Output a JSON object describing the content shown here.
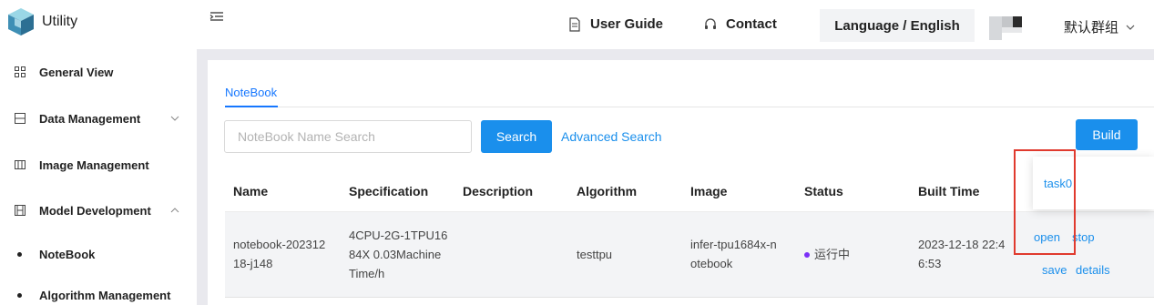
{
  "app": {
    "name": "Utility"
  },
  "header": {
    "user_guide": "User Guide",
    "contact": "Contact",
    "language": "Language / English",
    "group": "默认群组"
  },
  "sidebar": {
    "items": [
      {
        "label": "General View",
        "icon": "grid-icon"
      },
      {
        "label": "Data Management",
        "icon": "database-icon",
        "expanded": false
      },
      {
        "label": "Image Management",
        "icon": "image-icon"
      },
      {
        "label": "Model Development",
        "icon": "film-icon",
        "expanded": true
      },
      {
        "label": "NoteBook",
        "sub": true
      },
      {
        "label": "Algorithm Management",
        "sub": true
      }
    ]
  },
  "tabs": [
    {
      "label": "NoteBook",
      "active": true
    }
  ],
  "toolbar": {
    "search_placeholder": "NoteBook Name Search",
    "search_button": "Search",
    "advanced_search": "Advanced Search",
    "build_button": "Build"
  },
  "table": {
    "columns": [
      "Name",
      "Specification",
      "Description",
      "Algorithm",
      "Image",
      "Status",
      "Built Time"
    ],
    "rows": [
      {
        "name_line1": "notebook-202312",
        "name_line2": "18-j148",
        "spec_line1": "4CPU-2G-1TPU16",
        "spec_line2": "84X 0.03Machine",
        "spec_line3": "Time/h",
        "description": "",
        "algorithm": "testtpu",
        "image_line1": "infer-tpu1684x-n",
        "image_line2": "otebook",
        "status": "运行中",
        "built_line1": "2023-12-18 22:4",
        "built_line2": "6:53",
        "actions": {
          "open": "open",
          "stop": "stop",
          "save": "save",
          "details": "details"
        }
      }
    ]
  },
  "popover": {
    "item": "task0"
  },
  "colors": {
    "primary": "#1a8fec",
    "highlight": "#e03a2e",
    "status_dot": "#7b2ff7"
  }
}
